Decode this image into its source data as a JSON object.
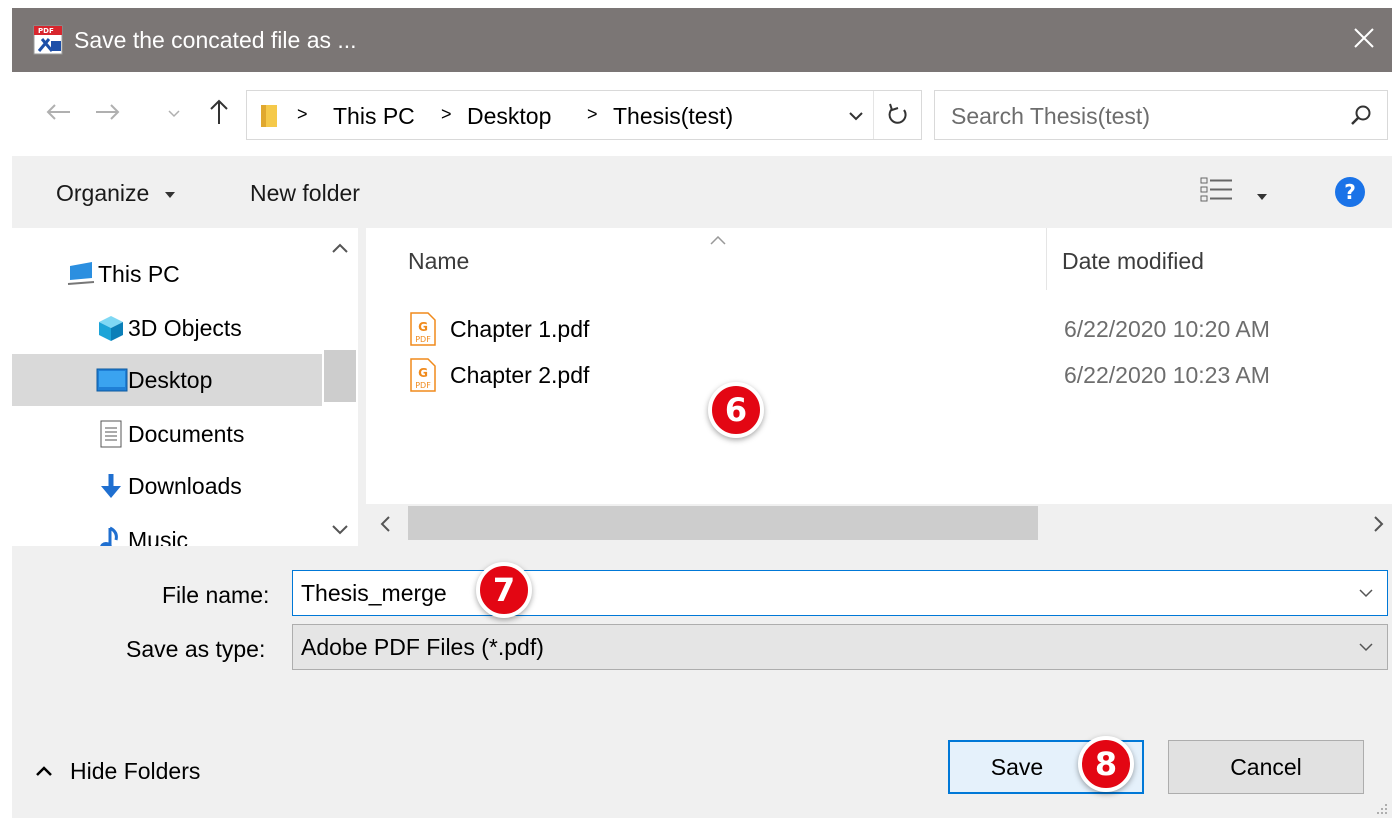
{
  "window": {
    "title": "Save the concated file as ...",
    "app_icon": "pdf-tools-icon",
    "close_icon": "close-icon"
  },
  "nav": {
    "back_icon": "arrow-left-icon",
    "forward_icon": "arrow-right-icon",
    "recent_icon": "chevron-down-icon",
    "up_icon": "arrow-up-icon",
    "breadcrumb": [
      "This PC",
      "Desktop",
      "Thesis(test)"
    ],
    "refresh_icon": "refresh-icon",
    "search_placeholder": "Search Thesis(test)",
    "search_icon": "search-icon"
  },
  "toolbar": {
    "organize_label": "Organize",
    "new_folder_label": "New folder",
    "view_icon": "details-view-icon",
    "help_icon": "help-icon"
  },
  "tree": {
    "items": [
      {
        "label": "This PC",
        "icon": "computer-icon",
        "selected": false
      },
      {
        "label": "3D Objects",
        "icon": "cube-icon",
        "selected": false
      },
      {
        "label": "Desktop",
        "icon": "desktop-icon",
        "selected": true
      },
      {
        "label": "Documents",
        "icon": "document-icon",
        "selected": false
      },
      {
        "label": "Downloads",
        "icon": "download-icon",
        "selected": false
      },
      {
        "label": "Music",
        "icon": "music-icon",
        "selected": false
      }
    ]
  },
  "files": {
    "columns": [
      "Name",
      "Date modified"
    ],
    "rows": [
      {
        "name": "Chapter 1.pdf",
        "date": "6/22/2020 10:20 AM",
        "icon": "pdf-file-icon"
      },
      {
        "name": "Chapter 2.pdf",
        "date": "6/22/2020 10:23 AM",
        "icon": "pdf-file-icon"
      }
    ]
  },
  "form": {
    "file_name_label": "File name:",
    "file_name_value": "Thesis_merge",
    "save_type_label": "Save as type:",
    "save_type_value": "Adobe PDF Files (*.pdf)"
  },
  "footer": {
    "hide_folders_label": "Hide Folders",
    "save_label": "Save",
    "cancel_label": "Cancel"
  },
  "annotations": {
    "step_6": "6",
    "step_7": "7",
    "step_8": "8"
  },
  "colors": {
    "titlebar": "#7b7675",
    "accent": "#0078d7",
    "badge": "#e30613",
    "selected": "#d9d9d9"
  }
}
